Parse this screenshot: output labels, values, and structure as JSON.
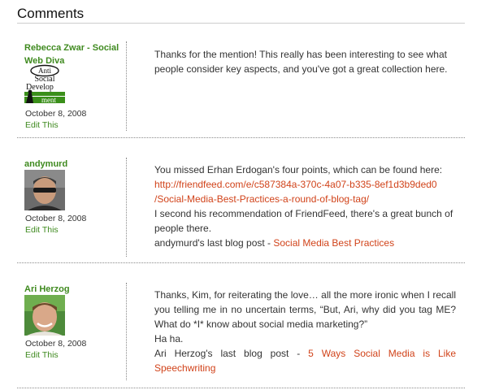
{
  "section": {
    "title": "Comments"
  },
  "comments": [
    {
      "author": "Rebecca Zwar - Social Web Diva",
      "avatar": {
        "icon": "anti-social-development-logo-icon",
        "logo_text": [
          "Anti",
          "Social",
          "Develop",
          "ment"
        ]
      },
      "date": "October 8, 2008",
      "edit_label": "Edit This",
      "text": "Thanks for the mention! This really has been interesting to see what people consider key aspects, and you've got a great collection here."
    },
    {
      "author": "andymurd",
      "avatar": {
        "icon": "user-photo-icon"
      },
      "date": "October 8, 2008",
      "edit_label": "Edit This",
      "intro": "You missed Erhan Erdogan's four points, which can be found here:",
      "link_url": "http://friendfeed.com/e/c587384a-370c-4a07-b335-8ef1d3b9ded0/Social-Media-Best-Practices-a-round-of-blog-tag/",
      "link_line1": "http://friendfeed.com/e/c587384a-370c-4a07-b335-8ef1d3b9ded0",
      "link_line2": "/Social-Media-Best-Practices-a-round-of-blog-tag/",
      "text2": "I second his recommendation of FriendFeed, there's a great bunch of people there.",
      "last_post_prefix": "andymurd's last blog post - ",
      "last_post_title": "Social Media Best Practices"
    },
    {
      "author": "Ari Herzog",
      "avatar": {
        "icon": "user-photo-icon"
      },
      "date": "October 8, 2008",
      "edit_label": "Edit This",
      "text": "Thanks, Kim, for reiterating the love… all the more ironic when I recall you telling me in no uncertain terms, “But, Ari, why did you tag ME? What do *I* know about social media marketing?”",
      "text2": "Ha ha.",
      "last_post_prefix": "Ari Herzog's last blog post - ",
      "last_post_title": "5 Ways Social Media is Like Speechwriting"
    }
  ],
  "colors": {
    "author": "#3f8a1f",
    "link": "#d1431a",
    "text": "#333333",
    "separator": "#8a8a8a"
  }
}
